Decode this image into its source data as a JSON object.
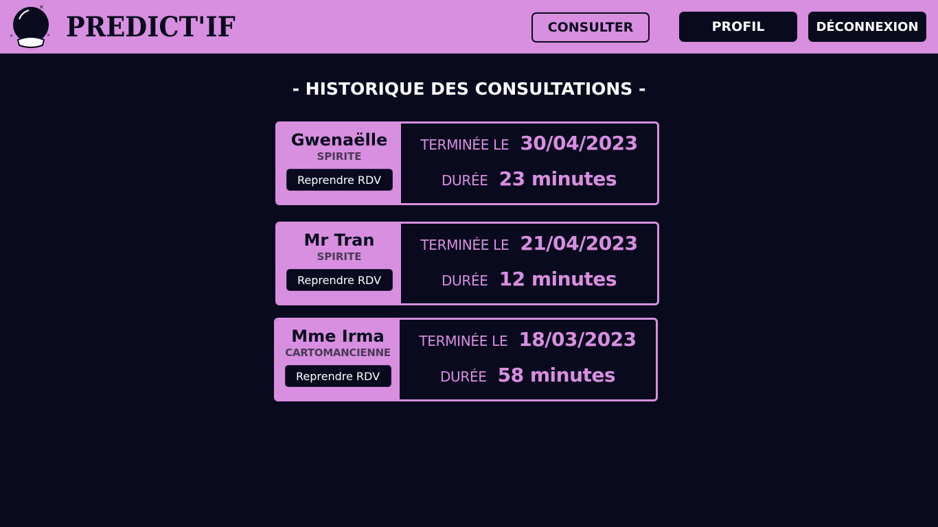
{
  "app": {
    "brand": "PREDICT'IF"
  },
  "nav": {
    "consulter": "CONSULTER",
    "profil": "PROFIL",
    "deconnexion": "DÉCONNEXION"
  },
  "page": {
    "title": "- HISTORIQUE DES CONSULTATIONS -"
  },
  "labels": {
    "terminee": "TERMINÉE LE",
    "duree": "DURÉE",
    "resume": "Reprendre RDV"
  },
  "consultations": [
    {
      "name": "Gwenaëlle",
      "type": "SPIRITE",
      "date": "30/04/2023",
      "duration": "23 minutes"
    },
    {
      "name": "Mr Tran",
      "type": "SPIRITE",
      "date": "21/04/2023",
      "duration": "12 minutes"
    },
    {
      "name": "Mme Irma",
      "type": "CARTOMANCIENNE",
      "date": "18/03/2023",
      "duration": "58 minutes"
    }
  ],
  "colors": {
    "accent": "#d88fe0",
    "background": "#0a0a1e"
  },
  "icons": {
    "logo": "crystal-ball-icon"
  }
}
